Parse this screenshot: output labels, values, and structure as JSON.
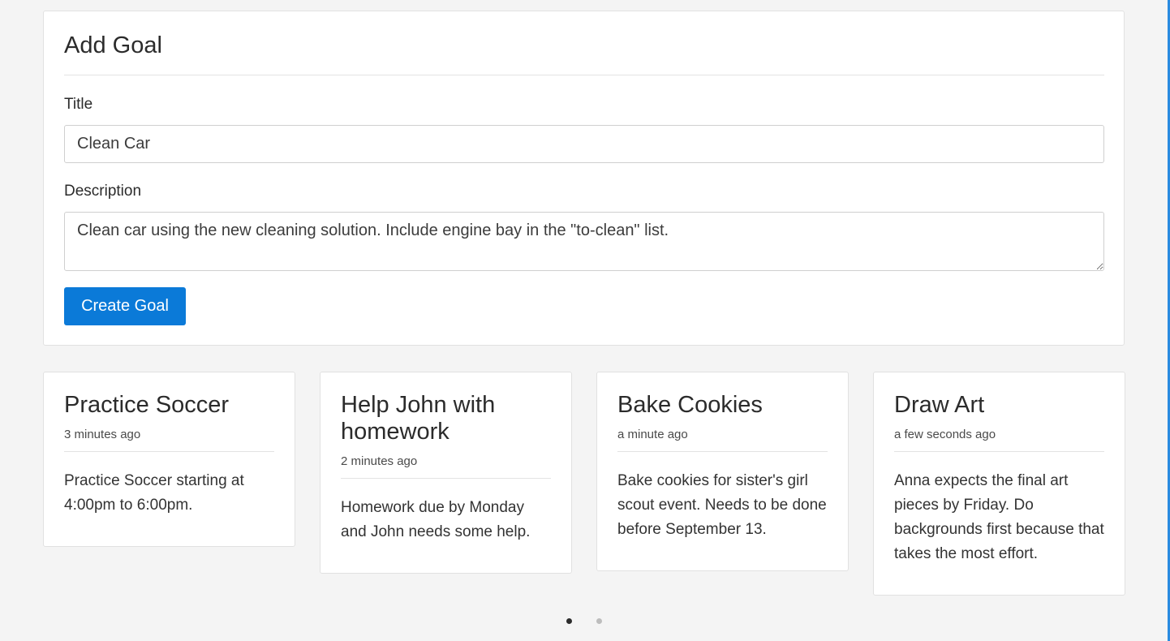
{
  "form": {
    "heading": "Add Goal",
    "title_label": "Title",
    "title_value": "Clean Car",
    "description_label": "Description",
    "description_value": "Clean car using the new cleaning solution. Include engine bay in the \"to-clean\" list.",
    "submit_label": "Create Goal"
  },
  "goals": [
    {
      "title": "Practice Soccer",
      "time": "3 minutes ago",
      "description": "Practice Soccer starting at 4:00pm to 6:00pm."
    },
    {
      "title": "Help John with homework",
      "time": "2 minutes ago",
      "description": "Homework due by Monday and John needs some help."
    },
    {
      "title": "Bake Cookies",
      "time": "a minute ago",
      "description": "Bake cookies for sister's girl scout event. Needs to be done before September 13."
    },
    {
      "title": "Draw Art",
      "time": "a few seconds ago",
      "description": "Anna expects the final art pieces by Friday. Do backgrounds first because that takes the most effort."
    }
  ],
  "carousel": {
    "page_count": 2,
    "active_page": 1
  },
  "colors": {
    "accent": "#0b7ad8",
    "background": "#f4f4f4",
    "card": "#ffffff"
  }
}
